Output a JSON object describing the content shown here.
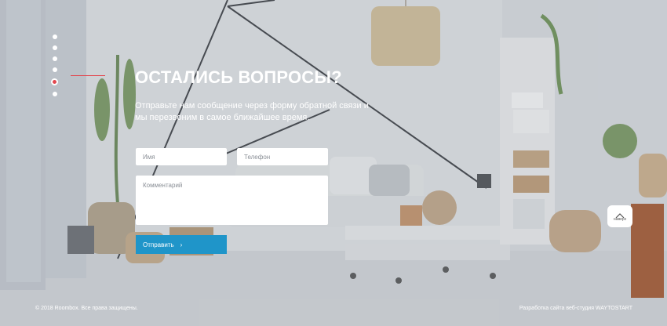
{
  "nav": {
    "dots": [
      "section-1",
      "section-2",
      "section-3",
      "section-4",
      "section-5",
      "section-6"
    ],
    "active_index": 4
  },
  "contact": {
    "title": "ОСТАЛИСЬ ВОПРОСЫ?",
    "subtitle": "Отправьте нам сообщение через форму обратной связи и мы перезвоним в самое ближайшее время.",
    "name_placeholder": "Имя",
    "phone_placeholder": "Телефон",
    "comment_placeholder": "Комментарий",
    "submit_label": "Отправить",
    "submit_arrow": "›"
  },
  "to_top": {
    "label": "наверх"
  },
  "footer": {
    "copyright": "© 2018 Roombox. Все права защищены.",
    "developer": "Разработка сайта веб-студия WAYTOSTART"
  },
  "colors": {
    "accent": "#e2474f",
    "button": "#1f95c9"
  }
}
